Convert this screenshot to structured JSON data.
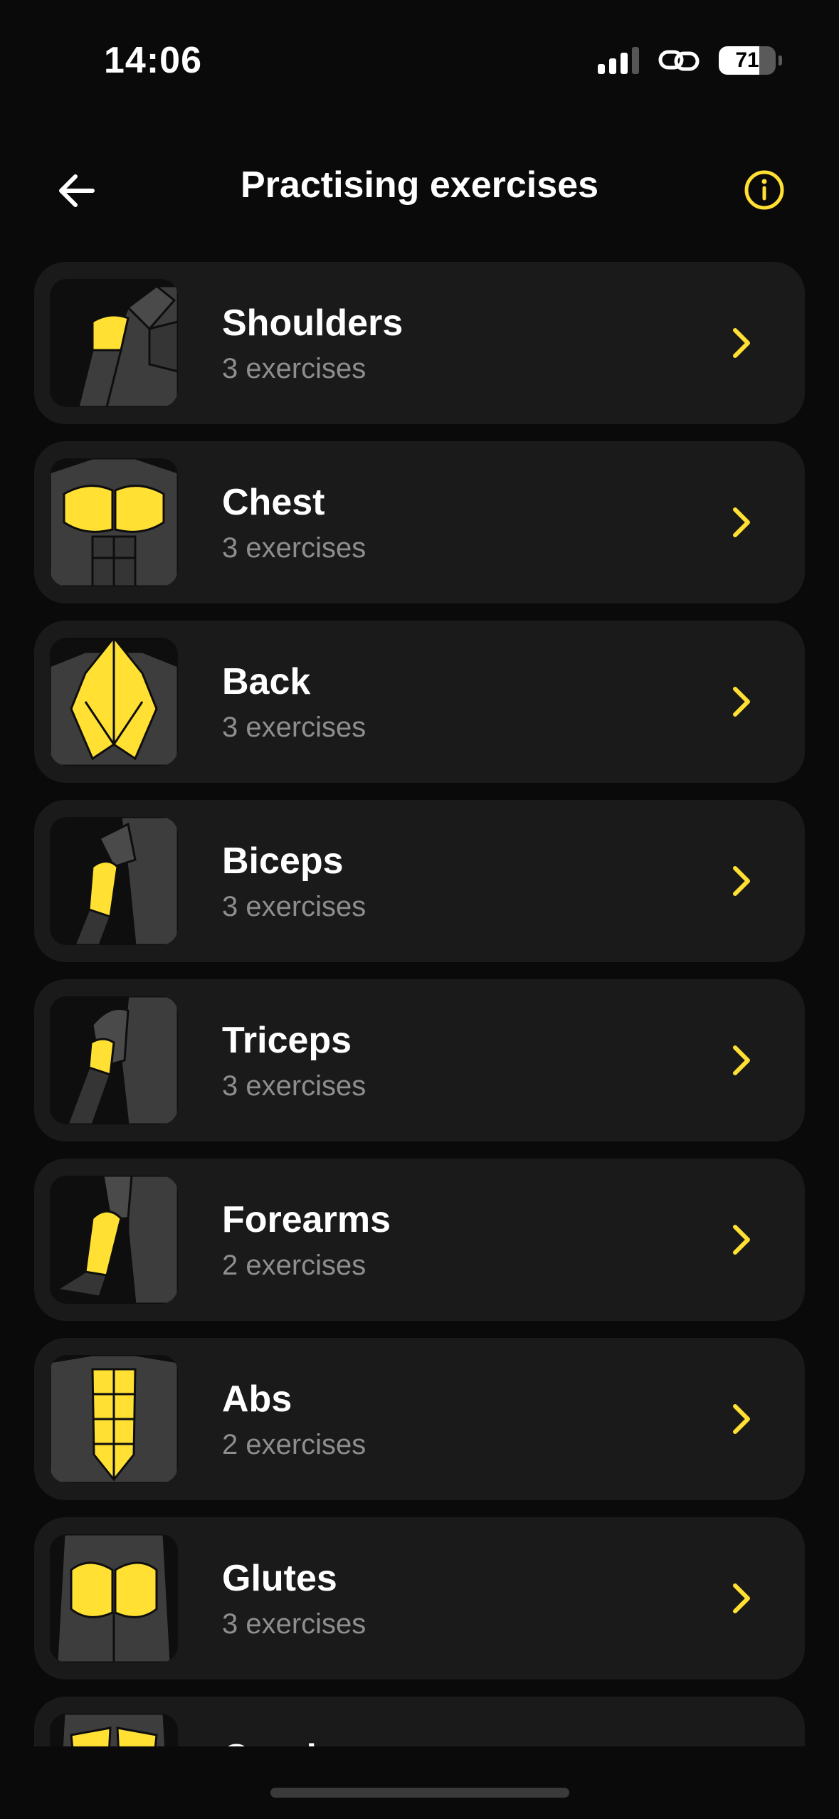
{
  "status_bar": {
    "time": "14:06",
    "battery_percent": "71",
    "battery_level": 0.71
  },
  "header": {
    "title": "Practising exercises"
  },
  "colors": {
    "accent": "#FFE033",
    "background": "#0a0a0a",
    "card": "#1a1a1a",
    "muscle_gray": "#3d3d3d"
  },
  "icons": {
    "back": "arrow-left-icon",
    "info": "info-icon",
    "chevron": "chevron-right-icon"
  },
  "muscle_groups": [
    {
      "name": "Shoulders",
      "count": "3 exercises"
    },
    {
      "name": "Chest",
      "count": "3 exercises"
    },
    {
      "name": "Back",
      "count": "3 exercises"
    },
    {
      "name": "Biceps",
      "count": "3 exercises"
    },
    {
      "name": "Triceps",
      "count": "3 exercises"
    },
    {
      "name": "Forearms",
      "count": "2 exercises"
    },
    {
      "name": "Abs",
      "count": "2 exercises"
    },
    {
      "name": "Glutes",
      "count": "3 exercises"
    },
    {
      "name": "Quads",
      "count": ""
    }
  ]
}
